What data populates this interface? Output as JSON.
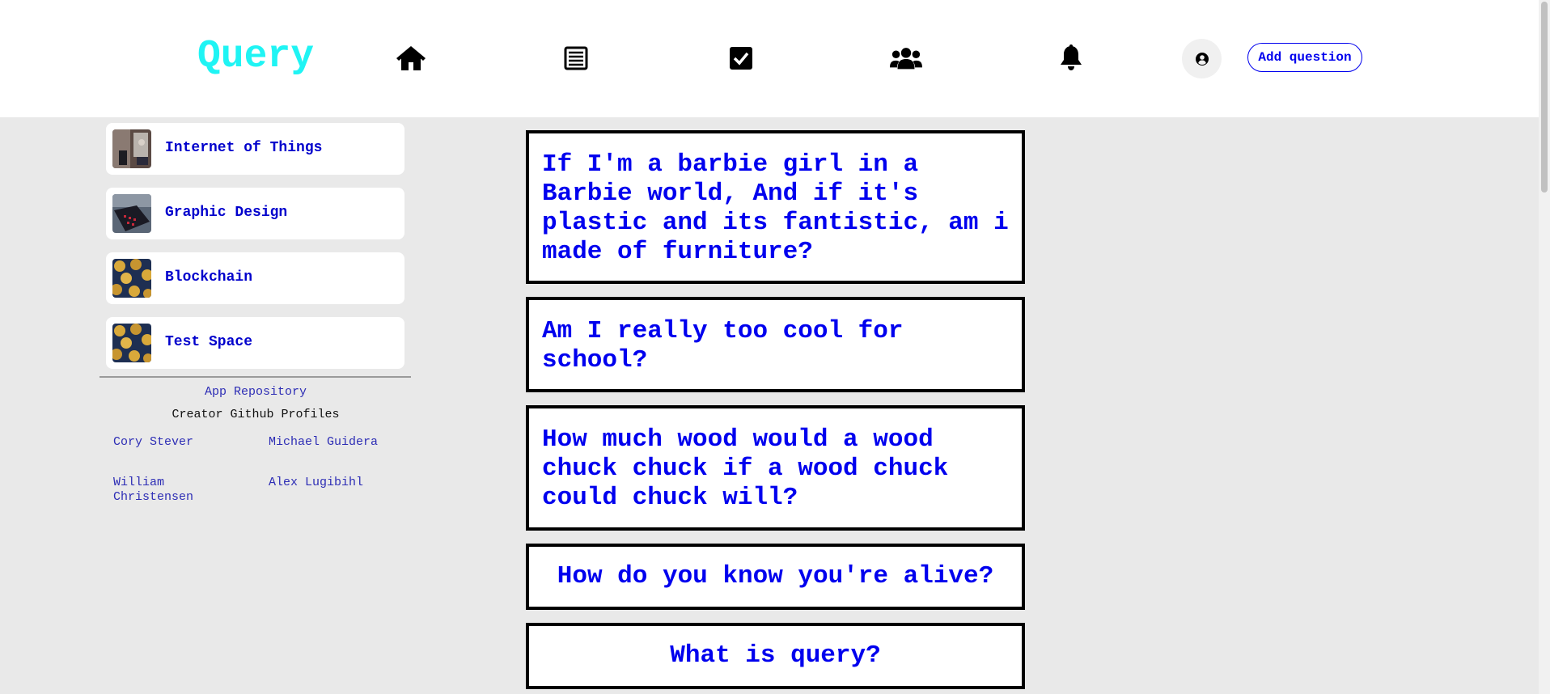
{
  "header": {
    "logo": "Query",
    "nav": [
      {
        "name": "home-icon"
      },
      {
        "name": "news-feed-icon"
      },
      {
        "name": "answered-checkbox-icon"
      },
      {
        "name": "users-icon"
      },
      {
        "name": "bell-icon"
      }
    ],
    "avatar_icon": "user-circle-icon",
    "add_question_label": "Add question"
  },
  "sidebar": {
    "spaces": [
      {
        "label": "Internet of Things",
        "thumbnail": "street-photo"
      },
      {
        "label": "Graphic Design",
        "thumbnail": "laptop-photo"
      },
      {
        "label": "Blockchain",
        "thumbnail": "bitcoin-pattern"
      },
      {
        "label": "Test Space",
        "thumbnail": "bitcoin-pattern"
      }
    ],
    "app_repository": "App Repository",
    "creators_heading": "Creator Github Profiles",
    "creators": [
      "Cory Stever",
      "Michael Guidera",
      "William Christensen",
      "Alex Lugibihl"
    ]
  },
  "feed": {
    "questions": [
      "If I'm a barbie girl in a Barbie world, And if it's plastic and its fantistic, am i made of furniture?",
      "Am I really too cool for school?",
      "How much wood would a wood chuck chuck if a wood chuck could chuck will?",
      "How do you know you're alive?",
      "What is query?"
    ]
  },
  "colors": {
    "logo": "#1ff4f4",
    "link": "#0000ee",
    "background": "#e9e9e9"
  }
}
